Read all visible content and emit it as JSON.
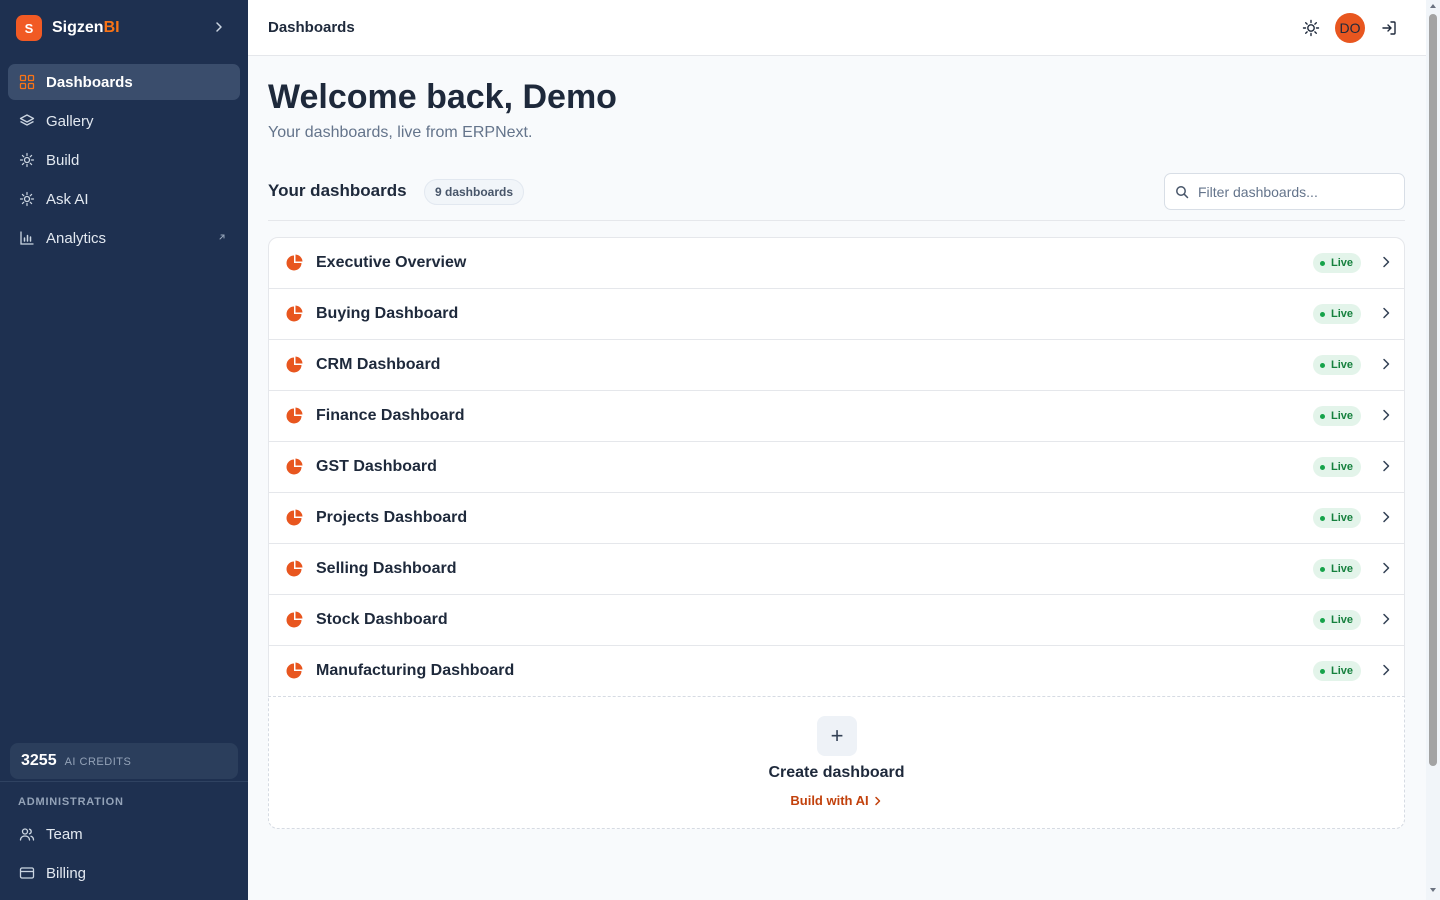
{
  "brand": {
    "logo_letter": "S",
    "name_main": "Sigzen",
    "name_accent": "BI",
    "accent_color": "#f97316"
  },
  "sidebar": {
    "items": [
      {
        "label": "Dashboards",
        "icon": "grid-icon",
        "active": true
      },
      {
        "label": "Gallery",
        "icon": "layers-icon"
      },
      {
        "label": "Build",
        "icon": "sparkle-icon"
      },
      {
        "label": "Ask AI",
        "icon": "sparkle-icon"
      },
      {
        "label": "Analytics",
        "icon": "bar-chart-icon",
        "external": true
      }
    ],
    "credits": {
      "value": "3255",
      "label": "AI CREDITS"
    },
    "admin": {
      "heading": "ADMINISTRATION",
      "items": [
        {
          "label": "Team",
          "icon": "users-icon"
        },
        {
          "label": "Billing",
          "icon": "credit-card-icon"
        }
      ]
    }
  },
  "topbar": {
    "title": "Dashboards",
    "avatar_initials": "DO",
    "avatar_color": "#e8561f"
  },
  "main": {
    "welcome": "Welcome back, Demo",
    "subtitle": "Your dashboards, live from ERPNext.",
    "section_title": "Your dashboards",
    "count_badge": "9 dashboards",
    "search_placeholder": "Filter dashboards...",
    "dashboards": [
      {
        "name": "Executive Overview",
        "status": "Live"
      },
      {
        "name": "Buying Dashboard",
        "status": "Live"
      },
      {
        "name": "CRM Dashboard",
        "status": "Live"
      },
      {
        "name": "Finance Dashboard",
        "status": "Live"
      },
      {
        "name": "GST Dashboard",
        "status": "Live"
      },
      {
        "name": "Projects Dashboard",
        "status": "Live"
      },
      {
        "name": "Selling Dashboard",
        "status": "Live"
      },
      {
        "name": "Stock Dashboard",
        "status": "Live"
      },
      {
        "name": "Manufacturing Dashboard",
        "status": "Live"
      }
    ],
    "create": {
      "plus": "+",
      "title": "Create dashboard",
      "link": "Build with AI"
    }
  },
  "colors": {
    "sidebar_bg": "#1e3050",
    "accent": "#f15a24",
    "live_green": "#16a34a"
  }
}
